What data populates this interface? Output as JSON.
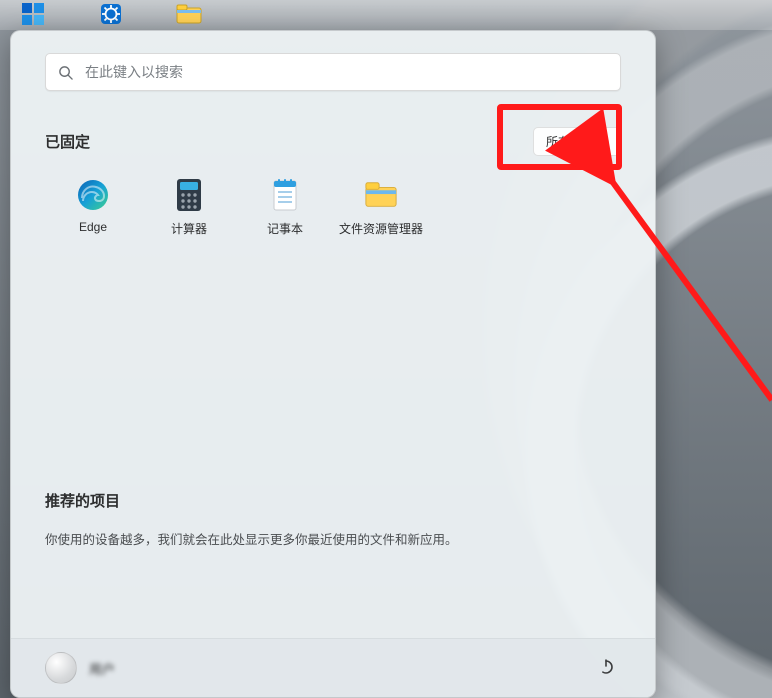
{
  "search": {
    "placeholder": "在此键入以搜索"
  },
  "pinned": {
    "title": "已固定",
    "allAppsLabel": "所有应用",
    "apps": [
      {
        "label": "Edge"
      },
      {
        "label": "计算器"
      },
      {
        "label": "记事本"
      },
      {
        "label": "文件资源管理器"
      }
    ]
  },
  "recommended": {
    "title": "推荐的项目",
    "subtitle": "你使用的设备越多，我们就会在此处显示更多你最近使用的文件和新应用。"
  },
  "footer": {
    "userName": "用户"
  }
}
